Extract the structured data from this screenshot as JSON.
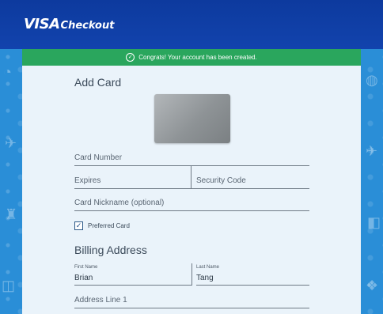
{
  "header": {
    "brand": "VISA",
    "product": "Checkout"
  },
  "banner": {
    "message": "Congrats! Your account has been created."
  },
  "add_card": {
    "title": "Add Card",
    "card_number_placeholder": "Card Number",
    "expires_placeholder": "Expires",
    "security_code_placeholder": "Security Code",
    "nickname_placeholder": "Card Nickname (optional)",
    "preferred_card_label": "Preferred Card",
    "preferred_card_checked": true
  },
  "billing": {
    "title": "Billing Address",
    "first_name_label": "First Name",
    "first_name_value": "Brian",
    "last_name_label": "Last Name",
    "last_name_value": "Tang",
    "address_line1_placeholder": "Address Line 1"
  },
  "colors": {
    "header": "#1243ad",
    "banner": "#2aa65d",
    "panel": "#eaf3fa",
    "pattern": "#2a8ed7"
  }
}
